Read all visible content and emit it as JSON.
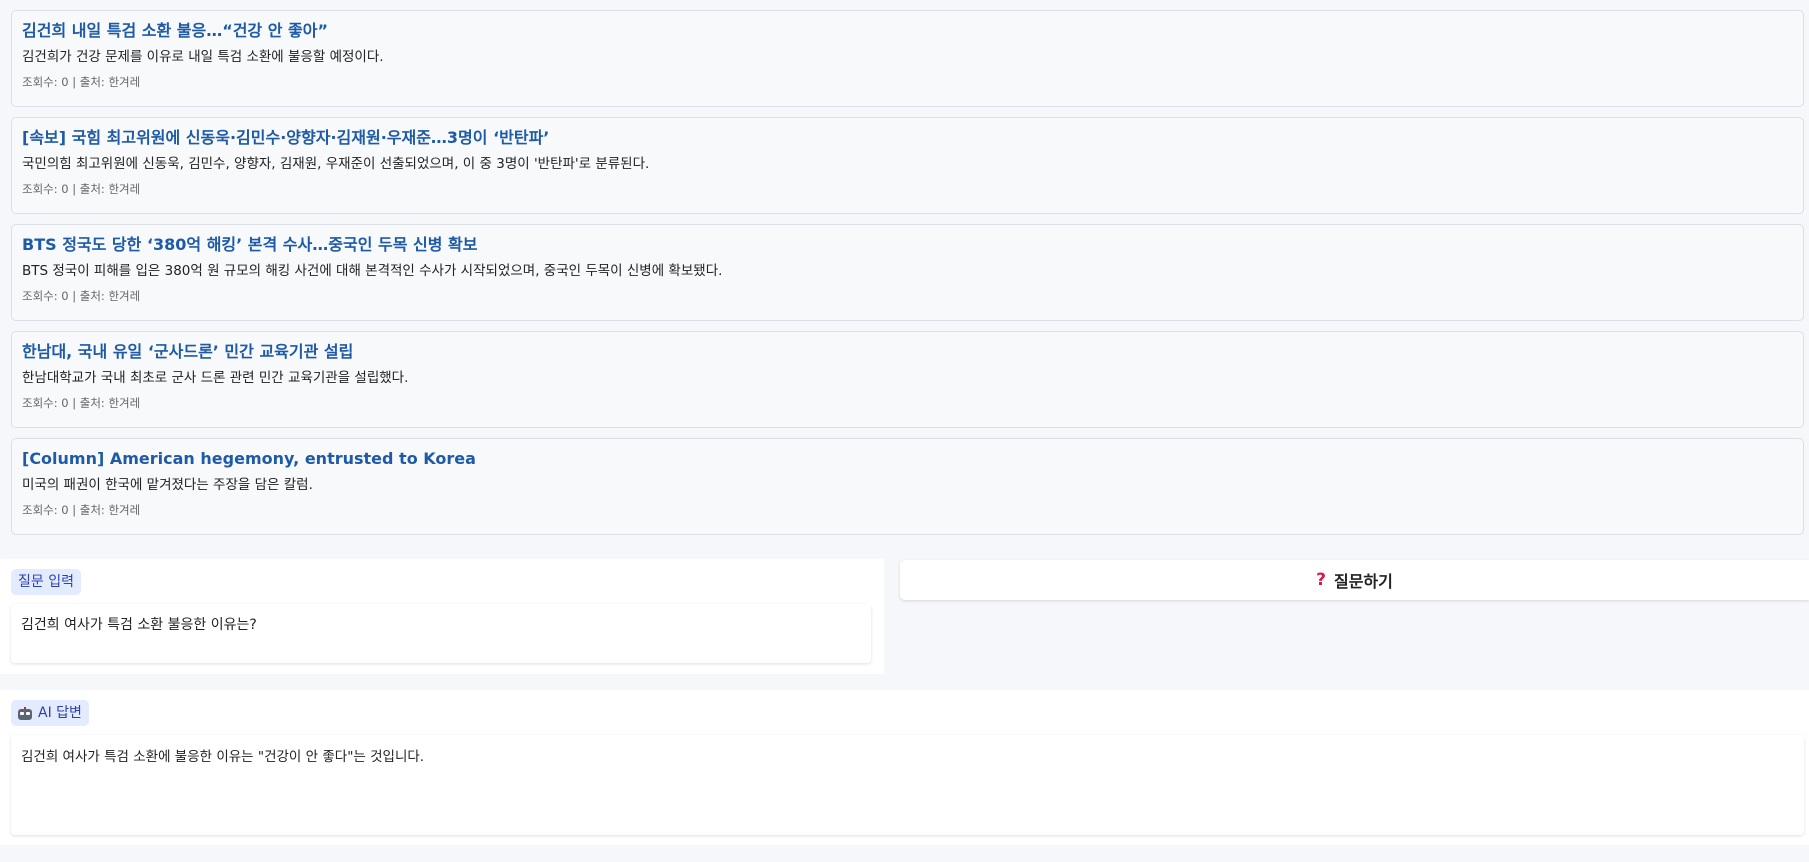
{
  "news": [
    {
      "title": "김건희 내일 특검 소환 불응…“건강 안 좋아”",
      "summary": "김건희가 건강 문제를 이유로 내일 특검 소환에 불응할 예정이다.",
      "meta": "조회수: 0 | 출처: 한겨레"
    },
    {
      "title": "[속보] 국힘 최고위원에 신동욱·김민수·양향자·김재원·우재준…3명이 ‘반탄파’",
      "summary": "국민의힘 최고위원에 신동욱, 김민수, 양향자, 김재원, 우재준이 선출되었으며, 이 중 3명이 '반탄파'로 분류된다.",
      "meta": "조회수: 0 | 출처: 한겨레"
    },
    {
      "title": "BTS 정국도 당한 ‘380억 해킹’ 본격 수사…중국인 두목 신병 확보",
      "summary": "BTS 정국이 피해를 입은 380억 원 규모의 해킹 사건에 대해 본격적인 수사가 시작되었으며, 중국인 두목이 신병에 확보됐다.",
      "meta": "조회수: 0 | 출처: 한겨레"
    },
    {
      "title": "한남대, 국내 유일 ‘군사드론’ 민간 교육기관 설립",
      "summary": "한남대학교가 국내 최초로 군사 드론 관련 민간 교육기관을 설립했다.",
      "meta": "조회수: 0 | 출처: 한겨레"
    },
    {
      "title": "[Column] American hegemony, entrusted to Korea",
      "summary": "미국의 패권이 한국에 맡겨졌다는 주장을 담은 칼럼.",
      "meta": "조회수: 0 | 출처: 한겨레"
    }
  ],
  "question": {
    "badge_label": "질문 입력",
    "value": "김건희 여사가 특검 소환 불응한 이유는?"
  },
  "ask_button": {
    "icon": "question-mark-icon",
    "label": "질문하기"
  },
  "answer": {
    "badge_icon": "robot-icon",
    "badge_label": "AI 답변",
    "text": "김건희 여사가 특검 소환에 불응한 이유는 \"건강이 안 좋다\"는 것입니다."
  },
  "colors": {
    "title_link": "#1e5aa7",
    "badge_bg": "#e3ebff",
    "badge_text": "#2e3fb0",
    "ask_icon": "#d81b46",
    "page_bg": "#f5f7fa"
  }
}
